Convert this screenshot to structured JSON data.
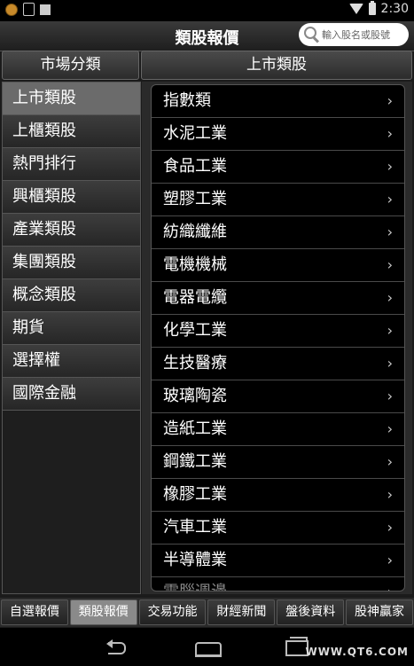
{
  "status_bar": {
    "time": "2:30"
  },
  "header": {
    "title": "類股報價",
    "search_placeholder": "輸入股名或股號"
  },
  "left_panel": {
    "title": "市場分類",
    "items": [
      "上市類股",
      "上櫃類股",
      "熱門排行",
      "興櫃類股",
      "產業類股",
      "集團類股",
      "概念類股",
      "期貨",
      "選擇權",
      "國際金融"
    ],
    "active_index": 0
  },
  "right_panel": {
    "title": "上市類股",
    "items": [
      "指數類",
      "水泥工業",
      "食品工業",
      "塑膠工業",
      "紡織纖維",
      "電機機械",
      "電器電纜",
      "化學工業",
      "生技醫療",
      "玻璃陶瓷",
      "造紙工業",
      "鋼鐵工業",
      "橡膠工業",
      "汽車工業",
      "半導體業"
    ],
    "partial_item": "電腦週邊",
    "chevron": "›"
  },
  "bottom_tabs": {
    "items": [
      "自選報價",
      "類股報價",
      "交易功能",
      "財經新聞",
      "盤後資料",
      "股神贏家"
    ],
    "active_index": 1
  },
  "watermark": "WWW.QT6.COM"
}
